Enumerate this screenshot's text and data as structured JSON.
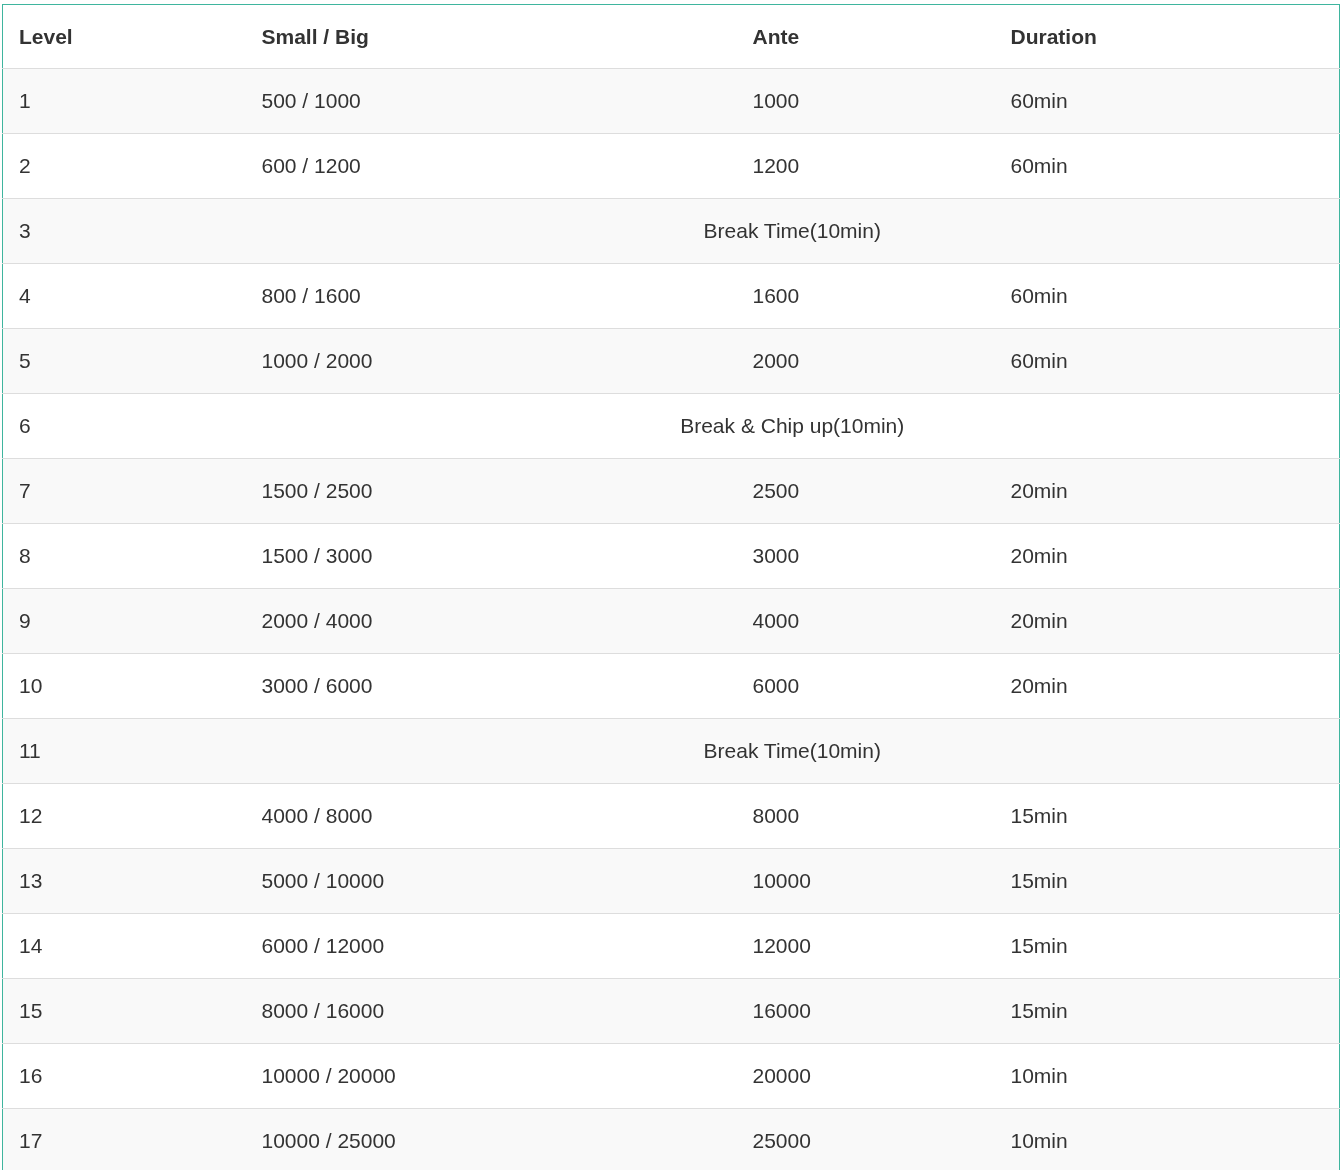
{
  "table": {
    "columns": [
      "Level",
      "Small / Big",
      "Ante",
      "Duration"
    ],
    "rows": [
      {
        "kind": "level",
        "level": "1",
        "blinds": "500 / 1000",
        "ante": "1000",
        "duration": "60min"
      },
      {
        "kind": "level",
        "level": "2",
        "blinds": "600 / 1200",
        "ante": "1200",
        "duration": "60min"
      },
      {
        "kind": "break",
        "level": "3",
        "note": "Break Time(10min)"
      },
      {
        "kind": "level",
        "level": "4",
        "blinds": "800 / 1600",
        "ante": "1600",
        "duration": "60min"
      },
      {
        "kind": "level",
        "level": "5",
        "blinds": "1000 / 2000",
        "ante": "2000",
        "duration": "60min"
      },
      {
        "kind": "break",
        "level": "6",
        "note": "Break & Chip up(10min)"
      },
      {
        "kind": "level",
        "level": "7",
        "blinds": "1500 / 2500",
        "ante": "2500",
        "duration": "20min"
      },
      {
        "kind": "level",
        "level": "8",
        "blinds": "1500 / 3000",
        "ante": "3000",
        "duration": "20min"
      },
      {
        "kind": "level",
        "level": "9",
        "blinds": "2000 / 4000",
        "ante": "4000",
        "duration": "20min"
      },
      {
        "kind": "level",
        "level": "10",
        "blinds": "3000 / 6000",
        "ante": "6000",
        "duration": "20min"
      },
      {
        "kind": "break",
        "level": "11",
        "note": "Break Time(10min)"
      },
      {
        "kind": "level",
        "level": "12",
        "blinds": "4000 / 8000",
        "ante": "8000",
        "duration": "15min"
      },
      {
        "kind": "level",
        "level": "13",
        "blinds": "5000 / 10000",
        "ante": "10000",
        "duration": "15min"
      },
      {
        "kind": "level",
        "level": "14",
        "blinds": "6000 / 12000",
        "ante": "12000",
        "duration": "15min"
      },
      {
        "kind": "level",
        "level": "15",
        "blinds": "8000 / 16000",
        "ante": "16000",
        "duration": "15min"
      },
      {
        "kind": "level",
        "level": "16",
        "blinds": "10000 / 20000",
        "ante": "20000",
        "duration": "10min"
      },
      {
        "kind": "level",
        "level": "17",
        "blinds": "10000 / 25000",
        "ante": "25000",
        "duration": "10min"
      }
    ]
  }
}
